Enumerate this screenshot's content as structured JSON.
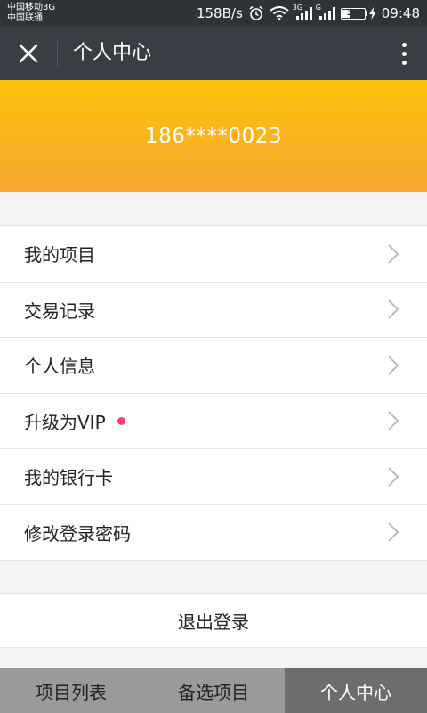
{
  "status_bar": {
    "carrier_1": "中国移动3G",
    "carrier_2": "中国联通",
    "net_speed": "158B/s",
    "signal_1_type": "3G",
    "signal_2_type": "G",
    "battery_level": "35",
    "battery_fraction": 0.35,
    "time": "09:48"
  },
  "title_bar": {
    "title": "个人中心",
    "close_icon": "close-icon",
    "more_icon": "more-vertical-icon"
  },
  "profile": {
    "phone": "186****0023"
  },
  "menu": {
    "items": [
      {
        "label": "我的项目",
        "badge": false
      },
      {
        "label": "交易记录",
        "badge": false
      },
      {
        "label": "个人信息",
        "badge": false
      },
      {
        "label": "升级为VIP",
        "badge": true
      },
      {
        "label": "我的银行卡",
        "badge": false
      },
      {
        "label": "修改登录密码",
        "badge": false
      }
    ]
  },
  "logout": {
    "label": "退出登录"
  },
  "tabs": [
    {
      "label": "项目列表",
      "active": false
    },
    {
      "label": "备选项目",
      "active": false
    },
    {
      "label": "个人中心",
      "active": true
    }
  ],
  "colors": {
    "banner_top": "#fcc30a",
    "banner_bottom": "#f6a631",
    "badge_dot": "#f2456a",
    "title_bar": "#3a3e44"
  }
}
